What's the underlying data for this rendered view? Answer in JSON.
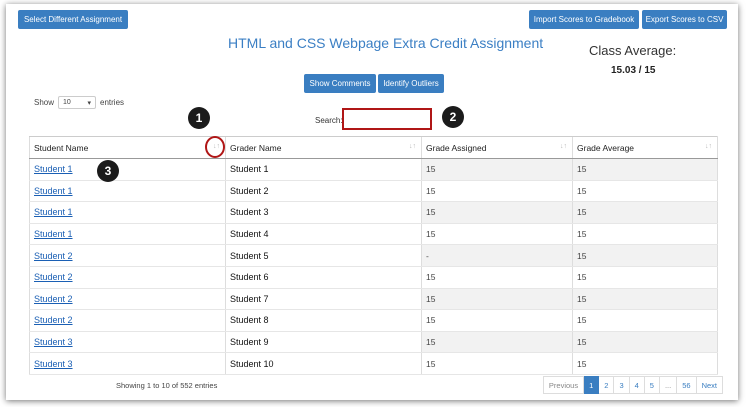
{
  "toolbar": {
    "select_assignment": "Select Different Assignment",
    "import_scores": "Import Scores to Gradebook",
    "export_scores": "Export Scores to CSV"
  },
  "title": "HTML and CSS Webpage Extra Credit Assignment",
  "class_average": {
    "label": "Class Average:",
    "value": "15.03 / 15"
  },
  "actions": {
    "show_comments": "Show Comments",
    "identify_outliers": "Identify Outliers"
  },
  "length": {
    "prefix": "Show",
    "selected": "10",
    "suffix": "entries"
  },
  "search": {
    "label": "Search:"
  },
  "callouts": [
    "1",
    "2",
    "3"
  ],
  "table": {
    "headers": [
      "Student Name",
      "Grader Name",
      "Grade Assigned",
      "Grade Average"
    ],
    "rows": [
      [
        "Student 1",
        "Student 1",
        "15",
        "15"
      ],
      [
        "Student 1",
        "Student 2",
        "15",
        "15"
      ],
      [
        "Student 1",
        "Student 3",
        "15",
        "15"
      ],
      [
        "Student 1",
        "Student 4",
        "15",
        "15"
      ],
      [
        "Student 2",
        "Student 5",
        "-",
        "15"
      ],
      [
        "Student 2",
        "Student 6",
        "15",
        "15"
      ],
      [
        "Student 2",
        "Student 7",
        "15",
        "15"
      ],
      [
        "Student 2",
        "Student 8",
        "15",
        "15"
      ],
      [
        "Student 3",
        "Student 9",
        "15",
        "15"
      ],
      [
        "Student 3",
        "Student 10",
        "15",
        "15"
      ]
    ]
  },
  "footer": {
    "info": "Showing 1 to 10 of 552 entries"
  },
  "pagination": [
    "Previous",
    "1",
    "2",
    "3",
    "4",
    "5",
    "...",
    "56",
    "Next"
  ],
  "pagination_active": "1",
  "colors": {
    "primary": "#3a7ec1",
    "highlight": "#b01616",
    "title": "#3b7fc4"
  }
}
